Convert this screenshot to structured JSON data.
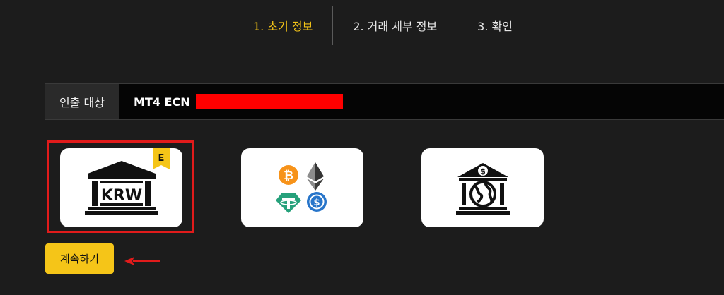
{
  "stepper": {
    "steps": [
      {
        "label": "1.  초기 정보",
        "active": true
      },
      {
        "label": "2. 거래 세부 정보",
        "active": false
      },
      {
        "label": "3. 확인",
        "active": false
      }
    ]
  },
  "withdraw_target": {
    "label": "인출 대상",
    "value": "MT4 ECN"
  },
  "methods": [
    {
      "icon": "bank-krw-icon",
      "text": "KRW",
      "badge": "E",
      "selected": true
    },
    {
      "icon": "crypto-coins-icon",
      "selected": false
    },
    {
      "icon": "international-bank-icon",
      "selected": false
    }
  ],
  "continue_button": {
    "label": "계속하기"
  },
  "colors": {
    "accent": "#f5c518",
    "highlight_frame": "#e11b1b",
    "redaction": "#ff0000"
  }
}
